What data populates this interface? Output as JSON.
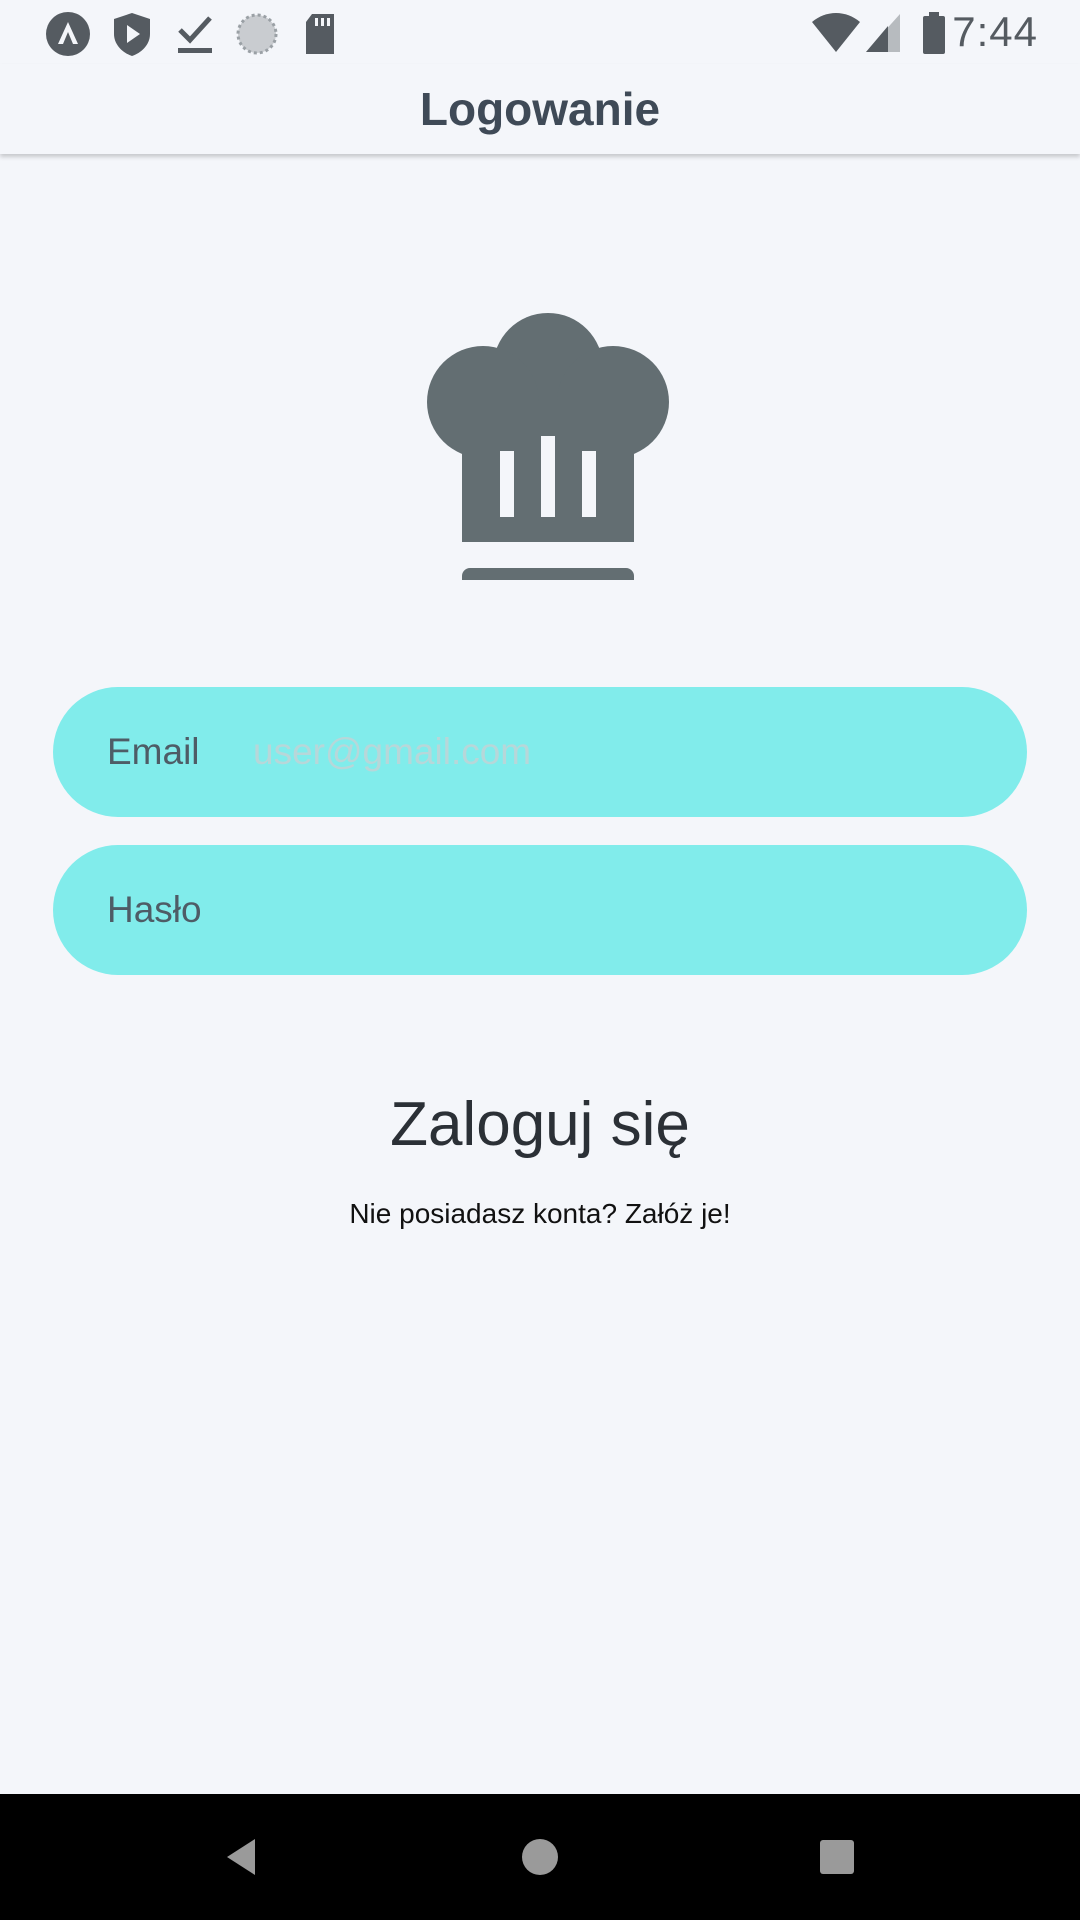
{
  "status_bar": {
    "time": "7:44",
    "left_icons": [
      "app-a-icon",
      "shield-icon",
      "download-done-icon",
      "sync-circle-icon",
      "sd-card-icon"
    ],
    "right_icons": [
      "wifi-icon",
      "cellular-signal-icon",
      "battery-icon"
    ]
  },
  "header": {
    "title": "Logowanie"
  },
  "logo": {
    "icon": "chef-hat-icon",
    "color": "#636e72"
  },
  "form": {
    "email": {
      "label": "Email",
      "placeholder": "user@gmail.com",
      "value": ""
    },
    "password": {
      "label": "Hasło",
      "value": ""
    },
    "field_color": "#81eceb"
  },
  "actions": {
    "login_label": "Zaloguj się",
    "register_prompt": "Nie posiadasz konta? Załóż je!"
  },
  "nav_bar": {
    "buttons": [
      "back-icon",
      "home-icon",
      "recents-icon"
    ]
  }
}
